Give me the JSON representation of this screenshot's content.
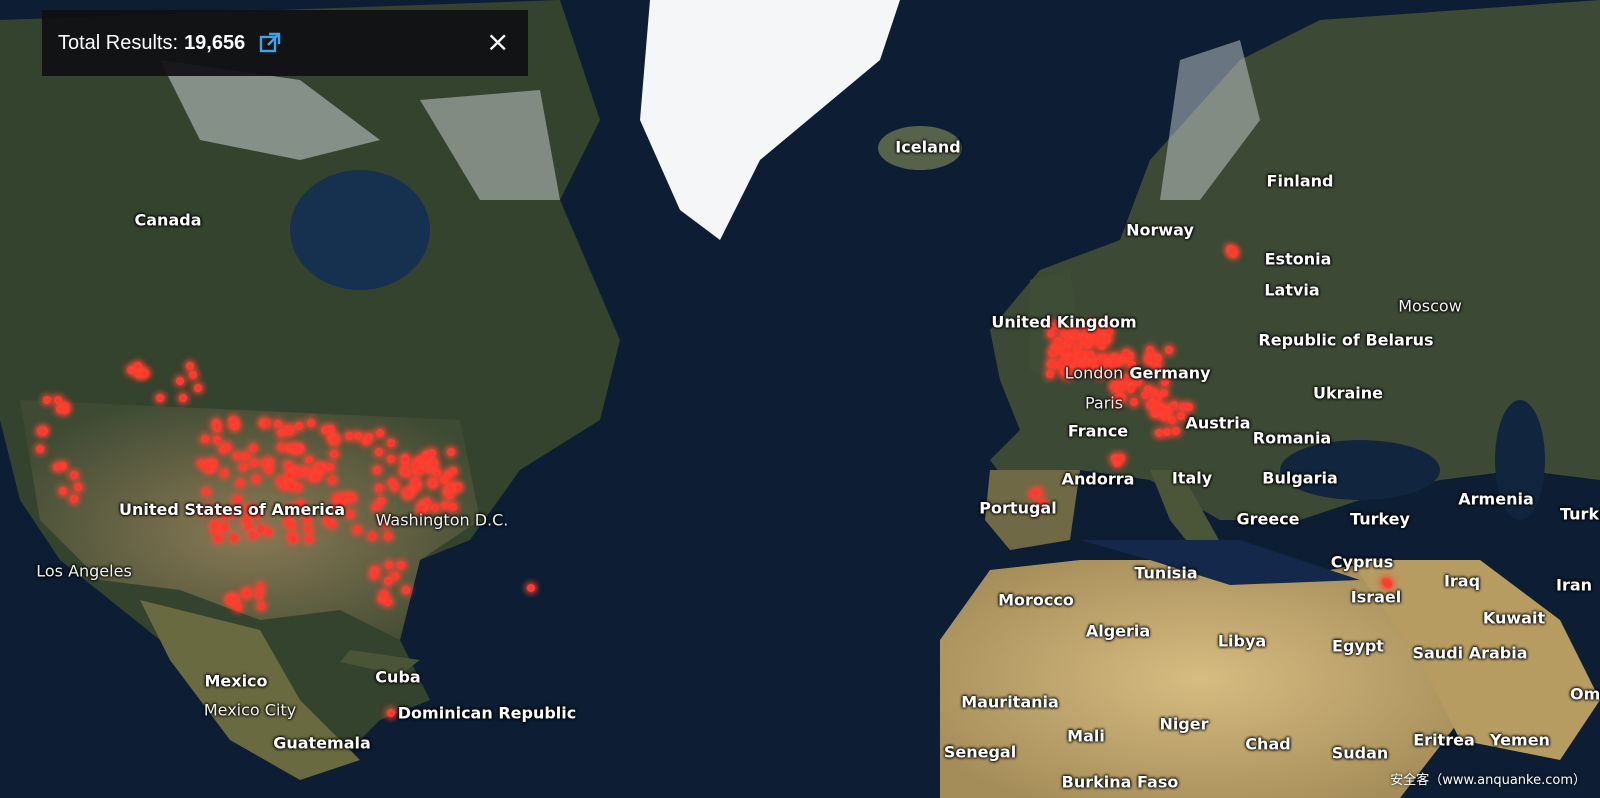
{
  "results_panel": {
    "label": "Total Results:",
    "count": "19,656",
    "open_icon": "external-link-icon",
    "close_icon": "close-icon",
    "close_glyph": "×"
  },
  "map_labels": {
    "countries": [
      "Canada",
      "United States of America",
      "Mexico",
      "Cuba",
      "Dominican Republic",
      "Guatemala",
      "Iceland",
      "Norway",
      "Finland",
      "Estonia",
      "Latvia",
      "United Kingdom",
      "Germany",
      "Republic of Belarus",
      "Ukraine",
      "France",
      "Austria",
      "Romania",
      "Andorra",
      "Italy",
      "Bulgaria",
      "Portugal",
      "Greece",
      "Turkey",
      "Armenia",
      "Turkmenistan",
      "Cyprus",
      "Iraq",
      "Iran",
      "Israel",
      "Kuwait",
      "Tunisia",
      "Morocco",
      "Algeria",
      "Libya",
      "Egypt",
      "Saudi Arabia",
      "Mauritania",
      "Mali",
      "Niger",
      "Chad",
      "Sudan",
      "Eritrea",
      "Yemen",
      "Senegal",
      "Burkina Faso",
      "Oman"
    ],
    "cities": [
      "Washington D.C.",
      "Los Angeles",
      "Mexico City",
      "Paris",
      "Moscow",
      "London"
    ]
  },
  "watermark": "安全客（www.anquanke.com）",
  "colors": {
    "ocean": "#0d1d33",
    "land_north": "#3a4a32",
    "land_desert": "#b9a06a",
    "dot": "#ff3b2f",
    "panel": "#0f0f12"
  }
}
